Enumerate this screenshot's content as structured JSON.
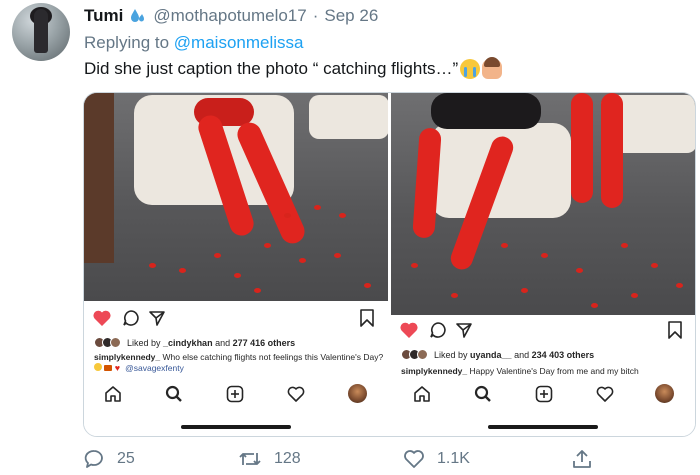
{
  "tweet": {
    "display_name": "Tumi",
    "handle": "@mothapotumelo17",
    "separator": "·",
    "date": "Sep 26",
    "reply_prefix": "Replying to",
    "reply_to": "@maisonmelissa",
    "text": "Did she just caption the photo “ catching flights…”",
    "emojis": [
      "loudly-crying-face",
      "woman-facepalming"
    ]
  },
  "posts": [
    {
      "liked_prefix": "Liked by",
      "liked_user": "_cindykhan",
      "liked_and": "and",
      "liked_count": "277 416 others",
      "caption_user": "simplykennedy_",
      "caption_text": "Who else catching flights not feelings this Valentine's Day?",
      "caption_mention": "@savagexfenty"
    },
    {
      "liked_prefix": "Liked by",
      "liked_user": "uyanda__",
      "liked_and": "and",
      "liked_count": "234 403 others",
      "caption_user": "simplykennedy_",
      "caption_text": "Happy Valentine's Day from me and my bitch"
    }
  ],
  "actions": {
    "reply_count": "25",
    "retweet_count": "128",
    "like_count": "1.1K"
  },
  "colors": {
    "accent": "#1da1f2",
    "secondary_text": "#657786",
    "ig_like_red": "#ed4956",
    "lingerie_red": "#e0251f"
  }
}
